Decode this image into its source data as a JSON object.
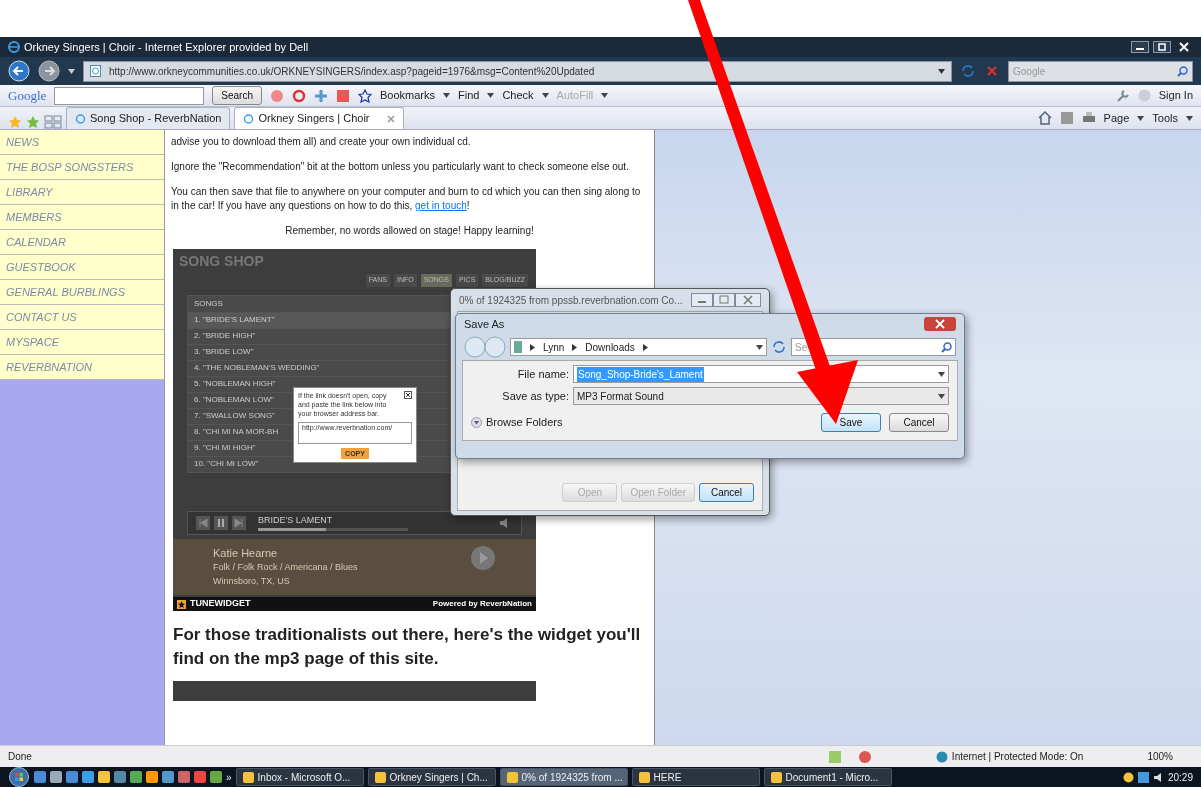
{
  "window": {
    "title": "Orkney Singers | Choir - Internet Explorer provided by Dell"
  },
  "address_bar": {
    "url": "http://www.orkneycommunities.co.uk/ORKNEYSINGERS/index.asp?pageid=1976&msg=Content%20Updated",
    "search_placeholder": "Google"
  },
  "google_toolbar": {
    "logo": "Google",
    "search_button": "Search",
    "items": [
      {
        "label": "Bookmarks",
        "disabled": false
      },
      {
        "label": "Find",
        "disabled": false
      },
      {
        "label": "Check",
        "disabled": false
      },
      {
        "label": "AutoFill",
        "disabled": true
      }
    ],
    "sign_in": "Sign In"
  },
  "tabs": [
    {
      "label": "Song Shop - ReverbNation",
      "selected": false
    },
    {
      "label": "Orkney Singers | Choir",
      "selected": true
    }
  ],
  "command_bar": [
    "Page",
    "Tools"
  ],
  "sidebar": {
    "items": [
      "NEWS",
      "THE BOSP SONGSTERS",
      "LIBRARY",
      "MEMBERS",
      "CALENDAR",
      "GUESTBOOK",
      "GENERAL BURBLINGS",
      "CONTACT US",
      "MYSPACE",
      "REVERBNATION"
    ]
  },
  "page": {
    "paragraphs": [
      {
        "kind": "text",
        "text": "advise you to download them all) and create your own individual cd."
      },
      {
        "kind": "text",
        "text": "Ignore the \"Recommendation\" bit at the bottom unless you particularly want to check someone else out."
      },
      {
        "kind": "link",
        "text": "You can then save that file to anywhere on your computer and burn to cd which you can then sing along to in the car! If you have any questions on how to do this, ",
        "link": "get in touch",
        "after": "!"
      },
      {
        "kind": "center",
        "text": "Remember, no words allowed on stage!  Happy learning!"
      }
    ],
    "heading": "For those traditionalists out there, here's the widget you'll find on the mp3 page of this site."
  },
  "widget": {
    "title": "SONG SHOP",
    "tabs": [
      {
        "label": "FANS",
        "selected": false
      },
      {
        "label": "INFO",
        "selected": false
      },
      {
        "label": "SONGS",
        "selected": true
      },
      {
        "label": "PICS",
        "selected": false
      },
      {
        "label": "BLOG/BUZZ",
        "selected": false
      }
    ],
    "list_header": "SONGS",
    "songs": [
      {
        "label": "1. \"BRIDE'S LAMENT\"",
        "selected": true
      },
      {
        "label": "2. \"BRIDE HIGH\"",
        "selected": false
      },
      {
        "label": "3. \"BRIDE LOW\"",
        "selected": false
      },
      {
        "label": "4. \"THE NOBLEMAN'S WEDDING\"",
        "selected": false
      },
      {
        "label": "5. \"NOBLEMAN HIGH\"",
        "selected": false
      },
      {
        "label": "6. \"NOBLEMAN LOW\"",
        "selected": false
      },
      {
        "label": "7. \"SWALLOW SONG\"",
        "selected": false
      },
      {
        "label": "8. \"CHI MI NA MOR-BH",
        "selected": false
      },
      {
        "label": "9. \"CHI MI HIGH\"",
        "selected": false
      },
      {
        "label": "10. \"CHI MI LOW\"",
        "selected": false
      }
    ],
    "now_playing": "BRIDE'S LAMENT",
    "progress": {
      "level": 0.45
    },
    "artist": {
      "name": "Katie Hearne",
      "genre": "Folk / Folk Rock / Americana / Blues",
      "location": "Winnsboro, TX, US"
    },
    "popup": {
      "text": "If the link doesn't open, copy and paste the link below into your browser address bar.",
      "url": "http://www.reverbnation.com/",
      "button": "COPY"
    },
    "footer": {
      "brand": "TUNEWIDGET",
      "powered": "Powered by ReverbNation"
    }
  },
  "download_dialog": {
    "title": "0% of 1924325 from ppssb.reverbnation.com Co...",
    "buttons": [
      {
        "label": "Open",
        "disabled": true
      },
      {
        "label": "Open Folder",
        "disabled": true
      },
      {
        "label": "Cancel",
        "disabled": false
      }
    ]
  },
  "save_dialog": {
    "title": "Save As",
    "breadcrumb": [
      "Lynn",
      "Downloads"
    ],
    "search_placeholder": "Se",
    "fields": [
      {
        "label": "File name:",
        "value": "Song_Shop-Bride's_Lament",
        "selected": true
      },
      {
        "label": "Save as type:",
        "value": "MP3 Format Sound",
        "selected": false
      }
    ],
    "browse": "Browse Folders",
    "buttons": [
      {
        "label": "Save",
        "default": true
      },
      {
        "label": "Cancel",
        "default": false
      }
    ]
  },
  "status_bar": {
    "text": "Done",
    "zone": "Internet | Protected Mode: On",
    "zoom": "100%"
  },
  "taskbar": {
    "overflow": "»",
    "tasks": [
      {
        "label": "Inbox - Microsoft O...",
        "selected": false
      },
      {
        "label": "Orkney Singers | Ch...",
        "selected": false
      },
      {
        "label": "0% of 1924325 from ...",
        "selected": true
      },
      {
        "label": "HERE",
        "selected": false
      },
      {
        "label": "Document1 - Micro...",
        "selected": false
      }
    ],
    "clock": "20:29"
  }
}
